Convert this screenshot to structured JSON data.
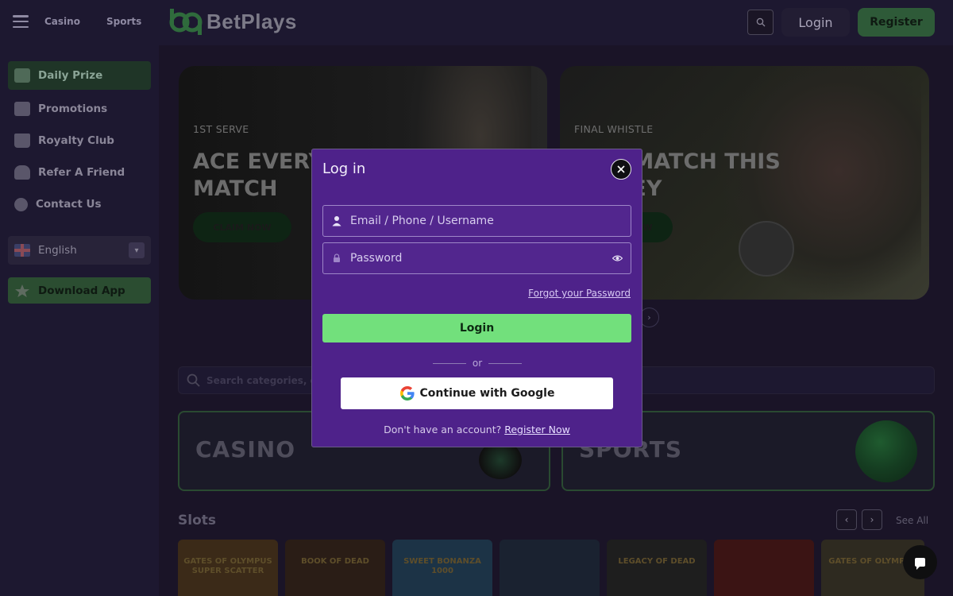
{
  "topbar": {
    "tabs": [
      "Casino",
      "Sports"
    ],
    "brand": "BetPlays",
    "login_label": "Login",
    "register_label": "Register"
  },
  "sidebar": {
    "items": [
      {
        "label": "Daily Prize",
        "icon": "gift-icon"
      },
      {
        "label": "Promotions",
        "icon": "promotions-icon"
      },
      {
        "label": "Royalty Club",
        "icon": "crown-icon"
      },
      {
        "label": "Refer A Friend",
        "icon": "friends-icon"
      },
      {
        "label": "Contact Us",
        "icon": "support-icon"
      }
    ],
    "language": "English",
    "download_label": "Download App"
  },
  "banners": [
    {
      "kicker": "1ST SERVE",
      "title": "ACE EVERY SINGLE MATCH",
      "button": "CLAIM NOW"
    },
    {
      "kicker": "FINAL WHISTLE",
      "title": "ONE MATCH THIS MONEY",
      "button": "CLAIM NOW"
    }
  ],
  "search": {
    "placeholder": "Search categories, games, providers"
  },
  "categories": [
    "CASINO",
    "SPORTS"
  ],
  "slots": {
    "title": "Slots",
    "see_all": "See All",
    "games": [
      {
        "name": "GATES OF OLYMPUS SUPER SCATTER",
        "color": "#3b2a18"
      },
      {
        "name": "BOOK OF DEAD",
        "color": "#2a1d16"
      },
      {
        "name": "SWEET BONANZA 1000",
        "color": "#1c3346"
      },
      {
        "name": "",
        "color": "#1a2230"
      },
      {
        "name": "LEGACY OF DEAD",
        "color": "#1e1e1e"
      },
      {
        "name": "",
        "color": "#3b1414"
      },
      {
        "name": "GATES OF OLYMPUS",
        "color": "#2e2a20"
      }
    ]
  },
  "modal": {
    "title": "Log in",
    "username_placeholder": "Email / Phone / Username",
    "password_placeholder": "Password",
    "forgot_label": "Forgot your Password",
    "login_label": "Login",
    "or_label": "or",
    "google_label": "Continue with Google",
    "signup_prompt": "Don't have an account?",
    "signup_link": "Register Now"
  }
}
